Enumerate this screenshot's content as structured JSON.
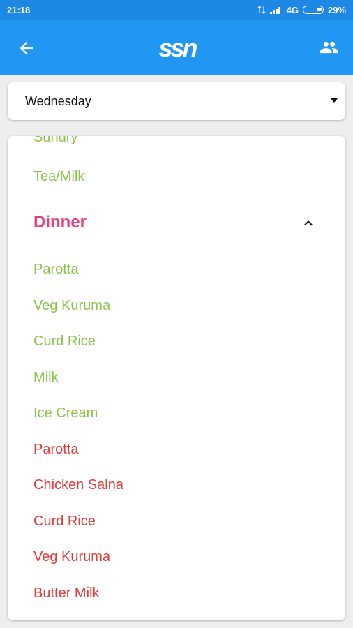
{
  "status": {
    "time": "21:18",
    "network": "4G",
    "battery": "29%"
  },
  "appbar": {
    "logo_text": "ssn"
  },
  "day_select": {
    "value": "Wednesday"
  },
  "menu": {
    "cut_off_item": "Sundry",
    "tea_item": "Tea/Milk",
    "section_title": "Dinner",
    "veg_items": [
      "Parotta",
      "Veg Kuruma",
      "Curd Rice",
      "Milk",
      "Ice Cream"
    ],
    "nonveg_items": [
      "Parotta",
      "Chicken Salna",
      "Curd Rice",
      "Veg Kuruma",
      "Butter Milk"
    ]
  },
  "colors": {
    "appbar": "#2196f3",
    "statusbar": "#1e88e5",
    "veg": "#8bc34a",
    "nonveg": "#e53935",
    "section": "#ec407a"
  }
}
